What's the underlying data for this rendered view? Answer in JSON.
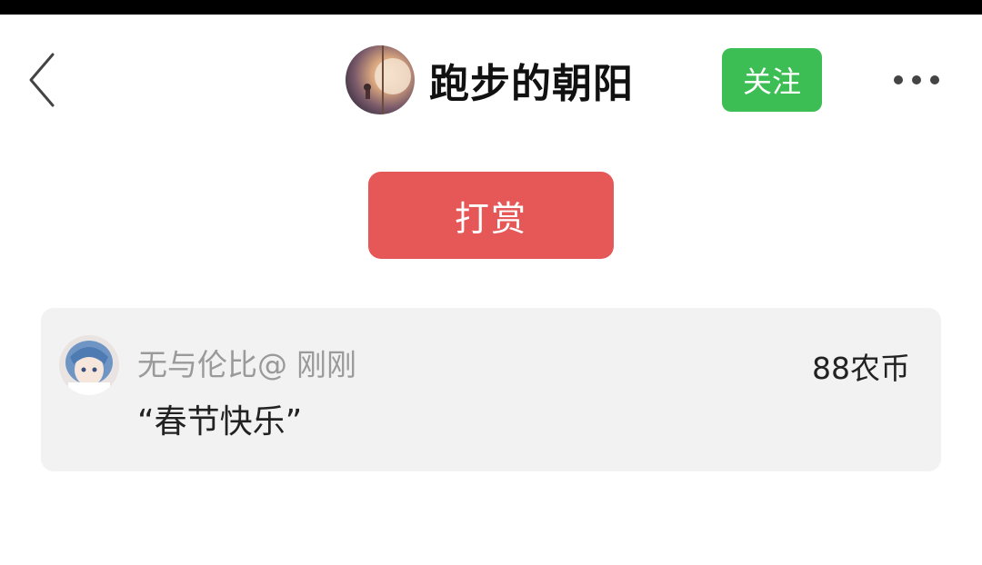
{
  "header": {
    "back_icon": "chevron-left-icon",
    "author_name": "跑步的朝阳",
    "follow_label": "关注",
    "more_icon": "more-dots-icon"
  },
  "reward": {
    "button_label": "打赏"
  },
  "reward_list": [
    {
      "donor_name": "无与伦比@",
      "time": "刚刚",
      "amount": "88农币",
      "message": "“春节快乐”"
    }
  ],
  "colors": {
    "follow_green": "#3cbe55",
    "reward_red": "#e65757",
    "card_bg": "#f2f2f2"
  }
}
